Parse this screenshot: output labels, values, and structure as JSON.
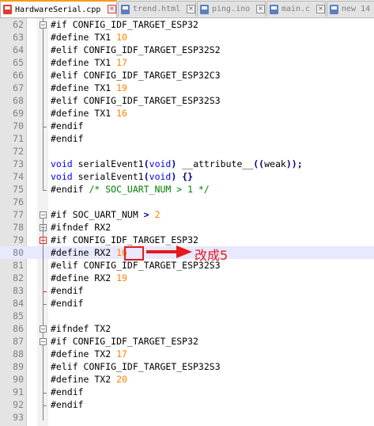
{
  "tabs": [
    {
      "label": "HardwareSerial.cpp",
      "active": true
    },
    {
      "label": "trend.html",
      "active": false
    },
    {
      "label": "ping.ino",
      "active": false
    },
    {
      "label": "main.c",
      "active": false
    },
    {
      "label": "new 14",
      "active": false
    }
  ],
  "code_lines": [
    {
      "n": "62",
      "t": "#if CONFIG_IDF_TARGET_ESP32"
    },
    {
      "n": "63",
      "t": "#define TX1 10"
    },
    {
      "n": "64",
      "t": "#elif CONFIG_IDF_TARGET_ESP32S2"
    },
    {
      "n": "65",
      "t": "#define TX1 17"
    },
    {
      "n": "66",
      "t": "#elif CONFIG_IDF_TARGET_ESP32C3"
    },
    {
      "n": "67",
      "t": "#define TX1 19"
    },
    {
      "n": "68",
      "t": "#elif CONFIG_IDF_TARGET_ESP32S3"
    },
    {
      "n": "69",
      "t": "#define TX1 16"
    },
    {
      "n": "70",
      "t": "#endif"
    },
    {
      "n": "71",
      "t": "#endif"
    },
    {
      "n": "72",
      "t": ""
    },
    {
      "n": "73",
      "t": "void serialEvent1(void) __attribute__((weak));"
    },
    {
      "n": "74",
      "t": "void serialEvent1(void) {}"
    },
    {
      "n": "75",
      "t": "#endif /* SOC_UART_NUM > 1 */"
    },
    {
      "n": "76",
      "t": ""
    },
    {
      "n": "77",
      "t": "#if SOC_UART_NUM > 2"
    },
    {
      "n": "78",
      "t": "#ifndef RX2"
    },
    {
      "n": "79",
      "t": "#if CONFIG_IDF_TARGET_ESP32"
    },
    {
      "n": "80",
      "t": "#define RX2 16"
    },
    {
      "n": "81",
      "t": "#elif CONFIG_IDF_TARGET_ESP32S3"
    },
    {
      "n": "82",
      "t": "#define RX2 19"
    },
    {
      "n": "83",
      "t": "#endif"
    },
    {
      "n": "84",
      "t": "#endif"
    },
    {
      "n": "85",
      "t": ""
    },
    {
      "n": "86",
      "t": "#ifndef TX2"
    },
    {
      "n": "87",
      "t": "#if CONFIG_IDF_TARGET_ESP32"
    },
    {
      "n": "88",
      "t": "#define TX2 17"
    },
    {
      "n": "89",
      "t": "#elif CONFIG_IDF_TARGET_ESP32S3"
    },
    {
      "n": "90",
      "t": "#define TX2 20"
    },
    {
      "n": "91",
      "t": "#endif"
    },
    {
      "n": "92",
      "t": "#endif"
    },
    {
      "n": "93",
      "t": ""
    }
  ],
  "current_line": "80",
  "annotation": {
    "text": "改成5"
  },
  "colors": {
    "keyword": "#0000ff",
    "comment": "#008000",
    "number": "#ff8000",
    "highlight": "#e8e8ff",
    "annotation": "#e6191d",
    "tab_accent": "#f39c1f"
  }
}
